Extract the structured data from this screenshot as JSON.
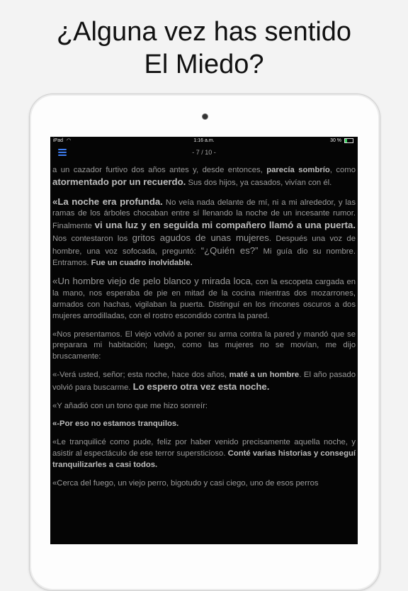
{
  "headline": {
    "line1": "¿Alguna vez has sentido",
    "line2": "El Miedo?"
  },
  "status_bar": {
    "device": "iPad",
    "time": "1:16 a.m.",
    "battery": "30 %"
  },
  "nav": {
    "menu_icon": "hamburger-menu-icon",
    "page_indicator": "- 7 / 10 -"
  },
  "paragraphs": [
    [
      {
        "t": "a un cazador furtivo dos años antes y, desde entonces, "
      },
      {
        "t": "parecía sombrío",
        "s": "bold"
      },
      {
        "t": ", como "
      },
      {
        "t": "atormentado por un recuerdo.",
        "s": "bigbold"
      },
      {
        "t": " Sus dos hijos, ya casados, vivían con él."
      }
    ],
    [
      {
        "t": "«La noche era profunda.",
        "s": "bigbold"
      },
      {
        "t": " No veía nada delante de mí, ni a mi alrededor, y las ramas de los árboles chocaban entre sí llenando la noche de un incesante rumor. Finalmente "
      },
      {
        "t": "vi una luz y en seguida mi compañero llamó a una puerta.",
        "s": "bigbold"
      },
      {
        "t": " Nos contestaron los "
      },
      {
        "t": "gritos agudos de unas mujeres",
        "s": "big"
      },
      {
        "t": ". Después una voz de hombre, una voz sofocada, preguntó: "
      },
      {
        "t": "“¿Quién es?”",
        "s": "big"
      },
      {
        "t": " Mi guía dio su nombre. Entramos. "
      },
      {
        "t": "Fue un cuadro inolvidable.",
        "s": "bold"
      }
    ],
    [
      {
        "t": "«Un hombre viejo de pelo blanco y mirada loca",
        "s": "big"
      },
      {
        "t": ", con la escopeta cargada en la mano, nos esperaba de pie en mitad de la cocina mientras dos mozarrones, armados con hachas, vigilaban la puerta. Distinguí en los rincones oscuros a dos mujeres arrodilladas, con el rostro escondido contra la pared."
      }
    ],
    [
      {
        "t": "«Nos presentamos. El viejo volvió a poner su arma contra la pared y mandó que se preparara mi habitación; luego, como las mujeres no se movían, me dijo bruscamente:"
      }
    ],
    [
      {
        "t": "«-Verá usted, señor; esta noche, hace dos años, "
      },
      {
        "t": "maté a un hombre",
        "s": "bold"
      },
      {
        "t": ". El año pasado volvió para buscarme. "
      },
      {
        "t": "Lo espero otra vez esta noche.",
        "s": "bigbold"
      }
    ],
    [
      {
        "t": "«Y añadió con un tono que me hizo sonreír:"
      }
    ],
    [
      {
        "t": "«-Por eso no estamos tranquilos.",
        "s": "bold"
      }
    ],
    [
      {
        "t": "«Le tranquilicé como pude, feliz por haber venido precisamente aquella noche, y asistir al espectáculo de ese terror supersticioso. "
      },
      {
        "t": "Conté varias historias y conseguí tranquilizarles a casi todos.",
        "s": "bold"
      }
    ],
    [
      {
        "t": "«Cerca del fuego, un viejo perro, bigotudo y casi ciego, uno de esos perros"
      }
    ]
  ]
}
